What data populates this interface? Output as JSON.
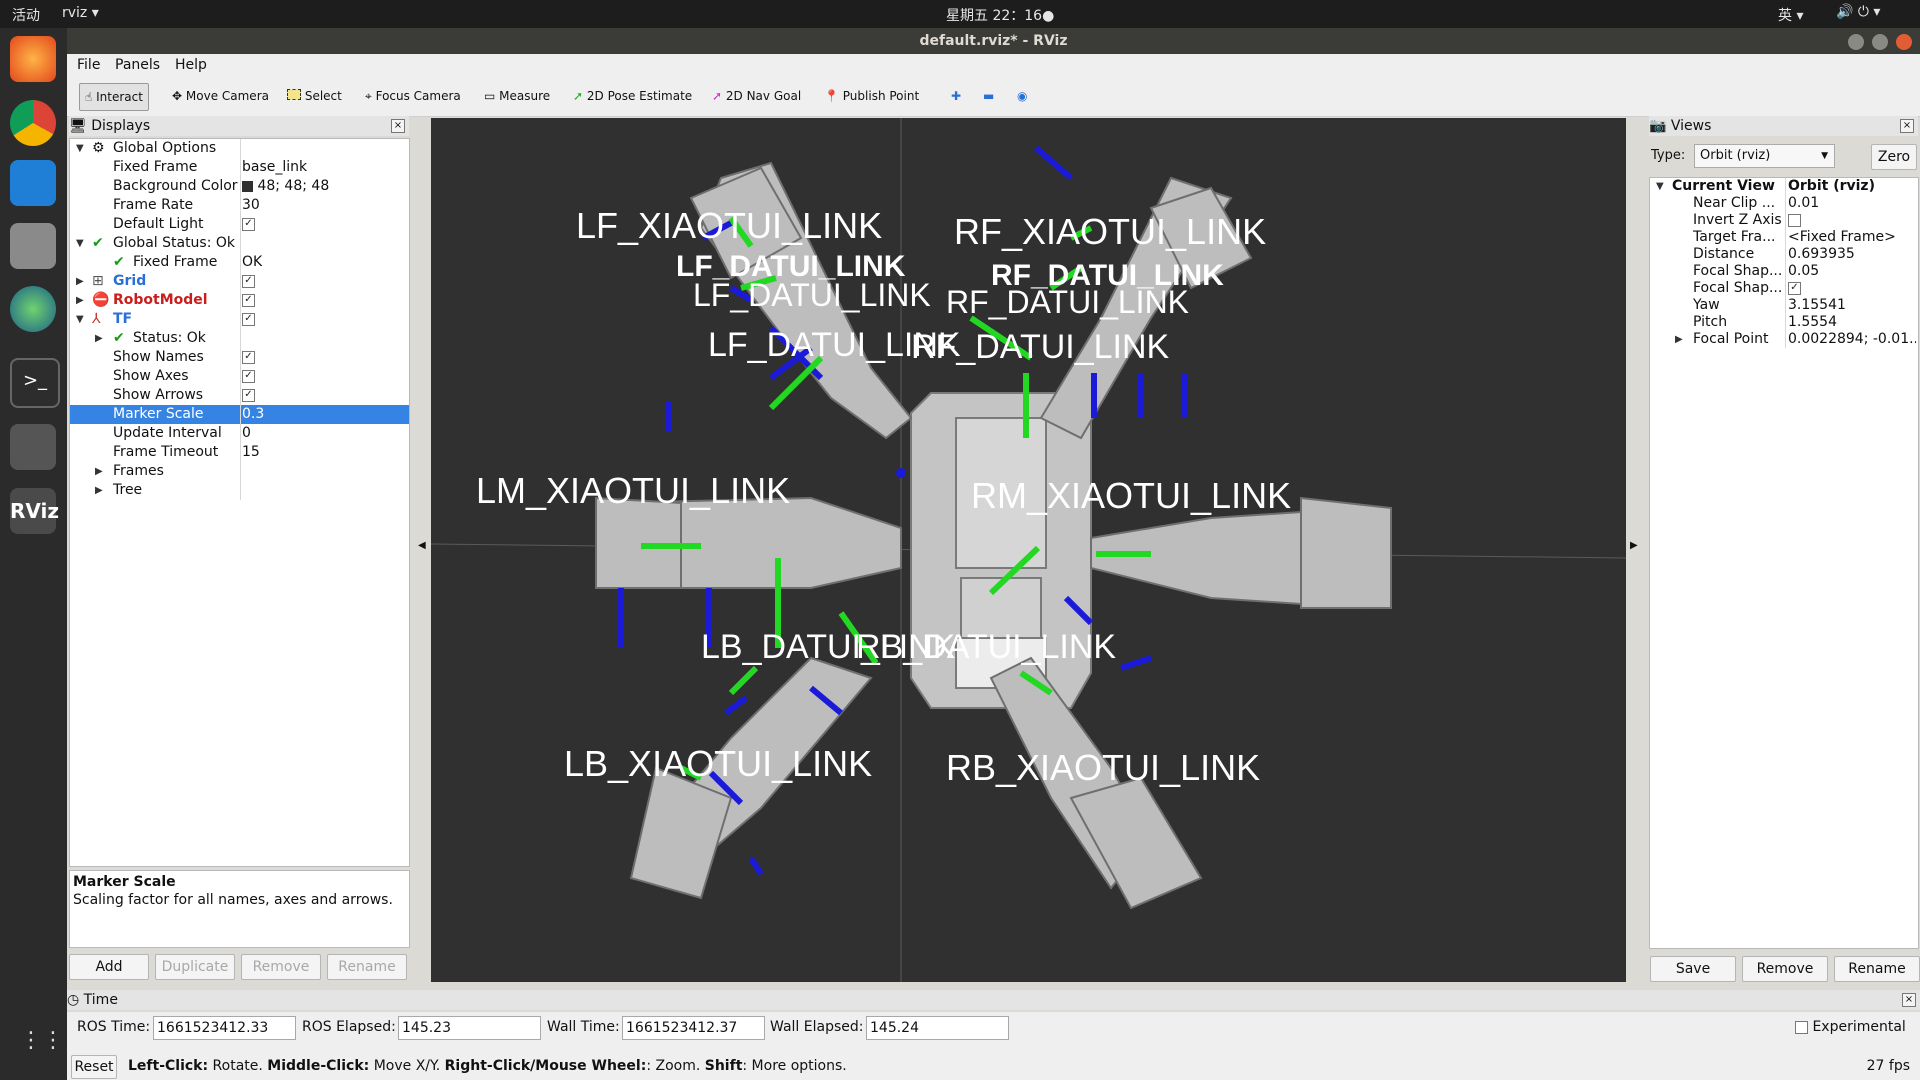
{
  "topbar": {
    "activities": "活动",
    "app": "rviz ▾",
    "clock": "星期五 22：16●",
    "ime": "英 ▾"
  },
  "window": {
    "title": "default.rviz* - RViz"
  },
  "menu": [
    "File",
    "Panels",
    "Help"
  ],
  "toolbar": {
    "interact": "Interact",
    "move_camera": "Move Camera",
    "select": "Select",
    "focus_camera": "Focus Camera",
    "measure": "Measure",
    "pose_estimate": "2D Pose Estimate",
    "nav_goal": "2D Nav Goal",
    "publish_point": "Publish Point"
  },
  "displays": {
    "title": "Displays",
    "rows": [
      {
        "name": "Global Options",
        "value": ""
      },
      {
        "name": "Fixed Frame",
        "value": "base_link"
      },
      {
        "name": "Background Color",
        "value": "48; 48; 48"
      },
      {
        "name": "Frame Rate",
        "value": "30"
      },
      {
        "name": "Default Light",
        "value": ""
      },
      {
        "name": "Global Status: Ok",
        "value": ""
      },
      {
        "name": "Fixed Frame",
        "value": "OK"
      },
      {
        "name": "Grid",
        "value": ""
      },
      {
        "name": "RobotModel",
        "value": ""
      },
      {
        "name": "TF",
        "value": ""
      },
      {
        "name": "Status: Ok",
        "value": ""
      },
      {
        "name": "Show Names",
        "value": ""
      },
      {
        "name": "Show Axes",
        "value": ""
      },
      {
        "name": "Show Arrows",
        "value": ""
      },
      {
        "name": "Marker Scale",
        "value": "0.3"
      },
      {
        "name": "Update Interval",
        "value": "0"
      },
      {
        "name": "Frame Timeout",
        "value": "15"
      },
      {
        "name": "Frames",
        "value": ""
      },
      {
        "name": "Tree",
        "value": ""
      }
    ],
    "desc_title": "Marker Scale",
    "desc_text": "Scaling factor for all names, axes and arrows.",
    "buttons": {
      "add": "Add",
      "duplicate": "Duplicate",
      "remove": "Remove",
      "rename": "Rename"
    }
  },
  "scene_labels": {
    "lf1": "LF_XIAOTUI_LINK",
    "lf2": "LF_DATUI_LINK",
    "lf3": "LF_DATUI_LINK",
    "rf1": "RF_XIAOTUI_LINK",
    "rf2": "RF_DATUI_LINK",
    "rf3": "RF_DATUI_LINK",
    "lm": "LM_XIAOTUI_LINK",
    "rm": "RM_XIAOTUI_LINK",
    "lb1": "LB_DATUI_LINK",
    "lb2": "LB_XIAOTUI_LINK",
    "rb1": "RB_DATUI_LINK",
    "rb2": "RB_XIAOTUI_LINK"
  },
  "views": {
    "title": "Views",
    "type_label": "Type:",
    "type_value": "Orbit (rviz)",
    "zero": "Zero",
    "current_view": "Current View",
    "current_view_value": "Orbit (rviz)",
    "rows": [
      {
        "k": "Near Clip ...",
        "v": "0.01"
      },
      {
        "k": "Invert Z Axis",
        "v": ""
      },
      {
        "k": "Target Fra...",
        "v": "<Fixed Frame>"
      },
      {
        "k": "Distance",
        "v": "0.693935"
      },
      {
        "k": "Focal Shap...",
        "v": "0.05"
      },
      {
        "k": "Focal Shap...",
        "v": ""
      },
      {
        "k": "Yaw",
        "v": "3.15541"
      },
      {
        "k": "Pitch",
        "v": "1.5554"
      },
      {
        "k": "Focal Point",
        "v": "0.0022894; -0.01..."
      }
    ],
    "buttons": {
      "save": "Save",
      "remove": "Remove",
      "rename": "Rename"
    }
  },
  "time": {
    "title": "Time",
    "ros_time_label": "ROS Time:",
    "ros_time": "1661523412.33",
    "ros_elapsed_label": "ROS Elapsed:",
    "ros_elapsed": "145.23",
    "wall_time_label": "Wall Time:",
    "wall_time": "1661523412.37",
    "wall_elapsed_label": "Wall Elapsed:",
    "wall_elapsed": "145.24",
    "experimental": "Experimental"
  },
  "status": {
    "reset": "Reset",
    "hint_b1": "Left-Click:",
    "hint_t1": " Rotate. ",
    "hint_b2": "Middle-Click:",
    "hint_t2": " Move X/Y. ",
    "hint_b3": "Right-Click/Mouse Wheel:",
    "hint_t3": ": Zoom. ",
    "hint_b4": "Shift",
    "hint_t4": ": More options.",
    "fps": "27 fps"
  }
}
